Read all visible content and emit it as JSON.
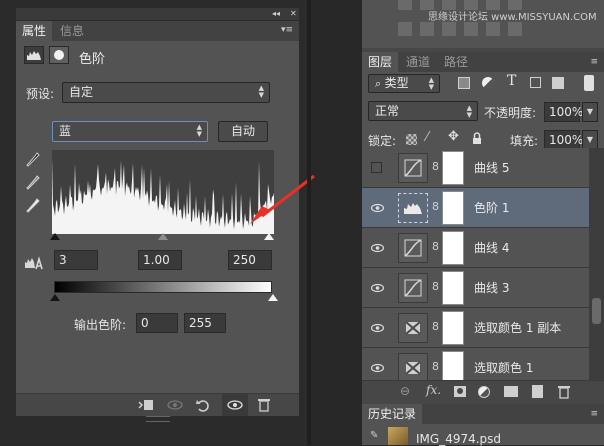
{
  "properties_panel": {
    "tabs": [
      "属性",
      "信息"
    ],
    "adjustment_title": "色阶",
    "preset_label": "预设:",
    "preset_value": "自定",
    "channel_value": "蓝",
    "auto_button": "自动",
    "input_levels": {
      "black": "3",
      "gamma": "1.00",
      "white": "250"
    },
    "output_label": "输出色阶:",
    "output_levels": {
      "black": "0",
      "white": "255"
    }
  },
  "layers_panel": {
    "tabs": [
      "图层",
      "通道",
      "路径"
    ],
    "filter_type": "类型",
    "blend_mode": "正常",
    "opacity_label": "不透明度:",
    "opacity_value": "100%",
    "lock_label": "锁定:",
    "fill_label": "填充:",
    "fill_value": "100%",
    "layers": [
      {
        "name": "曲线 5",
        "type": "curves",
        "visible": false,
        "selected": false
      },
      {
        "name": "色阶 1",
        "type": "levels",
        "visible": true,
        "selected": true
      },
      {
        "name": "曲线 4",
        "type": "curves",
        "visible": true,
        "selected": false
      },
      {
        "name": "曲线 3",
        "type": "curves",
        "visible": true,
        "selected": false
      },
      {
        "name": "选取颜色 1 副本",
        "type": "selective-color",
        "visible": true,
        "selected": false
      },
      {
        "name": "选取颜色 1",
        "type": "selective-color",
        "visible": true,
        "selected": false
      }
    ]
  },
  "history_panel": {
    "title": "历史记录",
    "items": [
      "IMG_4974.psd"
    ]
  },
  "watermark": "思缘设计论坛 www.MISSYUAN.COM",
  "colors": {
    "annotation_arrow": "#e8302a",
    "selected_layer": "#5f6a7b",
    "panel": "#535353"
  }
}
